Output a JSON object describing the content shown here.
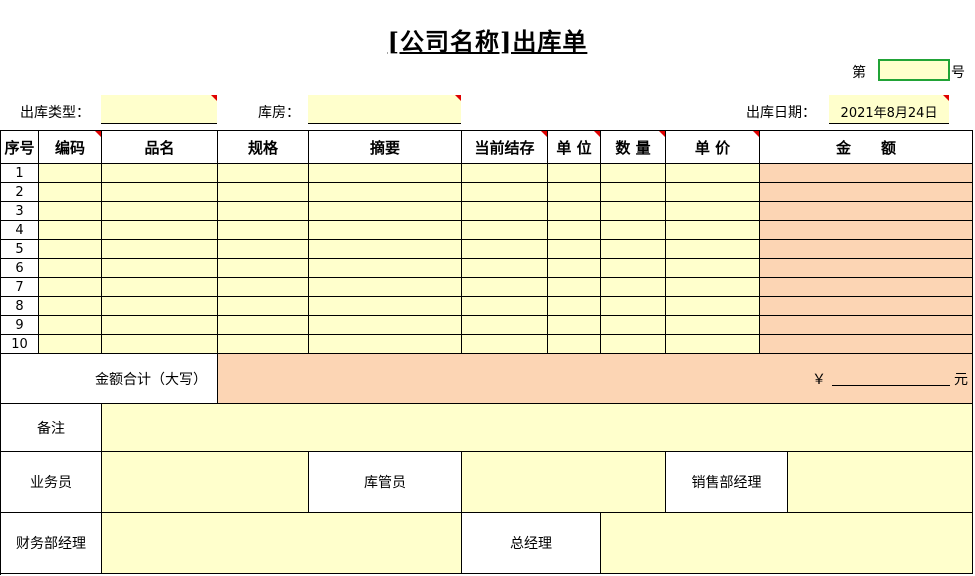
{
  "title": "[公司名称]出库单",
  "doc_no": {
    "prefix": "第",
    "suffix": "号",
    "value": ""
  },
  "fields": {
    "type_label": "出库类型：",
    "warehouse_label": "库房：",
    "date_label": "出库日期：",
    "date_value": "2021年8月24日"
  },
  "table": {
    "headers": [
      "序号",
      "编码",
      "品名",
      "规格",
      "摘要",
      "当前结存",
      "单 位",
      "数 量",
      "单 价",
      "金　　额"
    ],
    "row_numbers": [
      "1",
      "2",
      "3",
      "4",
      "5",
      "6",
      "7",
      "8",
      "9",
      "10"
    ]
  },
  "total": {
    "label": "金额合计（大写）",
    "currency": "￥",
    "unit": "元"
  },
  "footer": {
    "remarks_label": "备注",
    "salesperson_label": "业务员",
    "keeper_label": "库管员",
    "sales_manager_label": "销售部经理",
    "finance_manager_label": "财务部经理",
    "gm_label": "总经理"
  },
  "colors": {
    "input_fill": "#ffffcc",
    "amount_fill": "#fcd5b4",
    "selected_border": "#21a336",
    "comment_marker": "#e00000"
  }
}
